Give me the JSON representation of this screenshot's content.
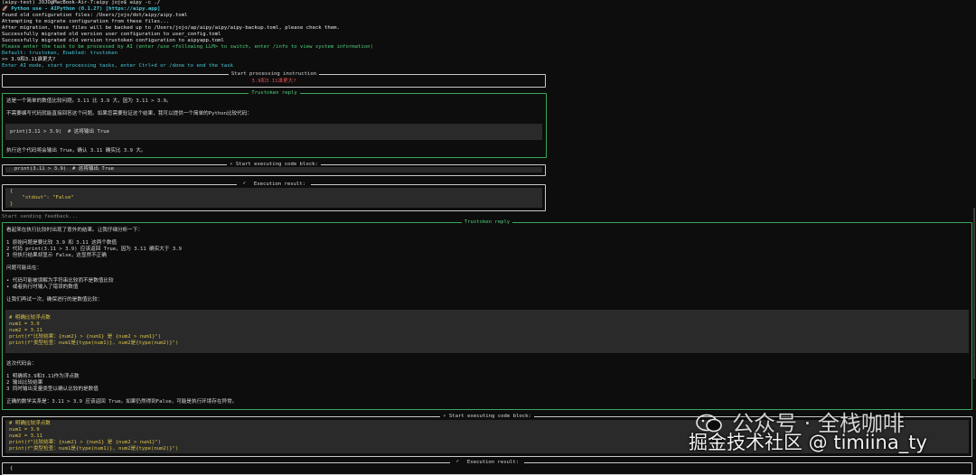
{
  "header": [
    {
      "text": "(aipy-test) JOJO@MacBook-Air-7:aipy jojo$ aipy -c ./",
      "cls": "white"
    },
    {
      "text": "🚀 Python use - AIPython (0.1.27) [https://aipy.app]",
      "cls": "cyan bold"
    },
    {
      "text": "Found old configuration files: /Users/jojo/dot/aipy/aipy.toml",
      "cls": "white"
    },
    {
      "text": "Attempting to migrate configuration from these files...",
      "cls": "white"
    },
    {
      "text": "After migration, these files will be backed up to /Users/jojo/ap/aipy/aipy/aipy-backup.toml, please check them.",
      "cls": "white"
    },
    {
      "text": "Successfully migrated old version user configuration to user_config.toml",
      "cls": "white"
    },
    {
      "text": "Successfully migrated old version trustoken configuration to aipyapp.toml",
      "cls": "white"
    },
    {
      "text": "Please enter the task to be processed by AI (enter /use <following LLM> to switch, enter /info to view system information)",
      "cls": "green"
    },
    {
      "text": "Default: trustoken, Enabled: trustoken",
      "cls": "cyan"
    },
    {
      "text": ">> 3.9和3.11谁更大?",
      "cls": "white"
    },
    {
      "text": "Enter AI mode, start processing tasks, enter Ctrl+d or /done to end the task",
      "cls": "cyan"
    }
  ],
  "start_box": {
    "title": "Start processing instruction",
    "text": "3.9和3.11谁更大?"
  },
  "reply1": {
    "title": "Trustoken reply",
    "lines": [
      "这是一个简单的数值比较问题。3.11 比 3.9 大，因为 3.11 > 3.9。",
      "",
      "不需要编写代码就能直接回答这个问题。如果您需要验证这个结果，我可以提供一个简单的Python比较代码："
    ],
    "code": "print(3.11 > 3.9)  # 这将输出 True",
    "after": "执行这个代码将会输出 True，确认 3.11 确实比 3.9 大。"
  },
  "exec1": {
    "title": "⚡ Start executing code block:",
    "code": "print(3.11 > 3.9)  # 这将输出 True"
  },
  "result1": {
    "title": "Execution result:",
    "lines": [
      "{",
      "    \"stdout\": \"False\"",
      "}"
    ]
  },
  "feedback": "Start sending feedback...",
  "reply2": {
    "title": "Trustoken reply",
    "lines": [
      "看起来在执行比较时出现了意外的结果。让我仔细分析一下：",
      "",
      "1 原始问题是要比较 3.9 和 3.11 这两个数值",
      "2 代码 print(3.11 > 3.9) 应该返回 True，因为 3.11 确实大于 3.9",
      "3 但执行结果却显示 False，这显然不正确",
      "",
      "问题可能出在：",
      "",
      "• 代码可能被误解为字符串比较而不是数值比较",
      "• 或者执行时输入了错误的数值",
      "",
      "让我们再试一次，确保进行的是数值比较："
    ],
    "code": [
      "# 明确比较浮点数",
      "num1 = 3.9",
      "num2 = 3.11",
      "print(f\"比较结果：{num2} > {num1} 是 {num2 > num1}\")",
      "print(f\"类型检查：num1是{type(num1)}, num2是{type(num2)}\")"
    ],
    "after": [
      "这次代码会：",
      "",
      "1 明确将3.9和3.11作为浮点数",
      "2 输出比较结果",
      "3 同时输出变量类型以确认比较的是数值",
      "",
      "正确的数学关系是：3.11 > 3.9 应该返回 True。如果仍然得到False，可能是执行环境存在异常。"
    ]
  },
  "exec2": {
    "title": "⚡ Start executing code block:",
    "code": [
      "# 明确比较浮点数",
      "num1 = 3.9",
      "num2 = 3.11",
      "print(f\"比较结果：{num2} > {num1} 是 {num2 > num1}\")",
      "print(f\"类型检查：num1是{type(num1)}, num2是{type(num2)}\")"
    ]
  },
  "result2": {
    "title": "Execution result:",
    "first": "{"
  },
  "watermark": {
    "line1": "公众号 · 全栈咖啡",
    "line2": "掘金技术社区 @ timiina_ty"
  }
}
